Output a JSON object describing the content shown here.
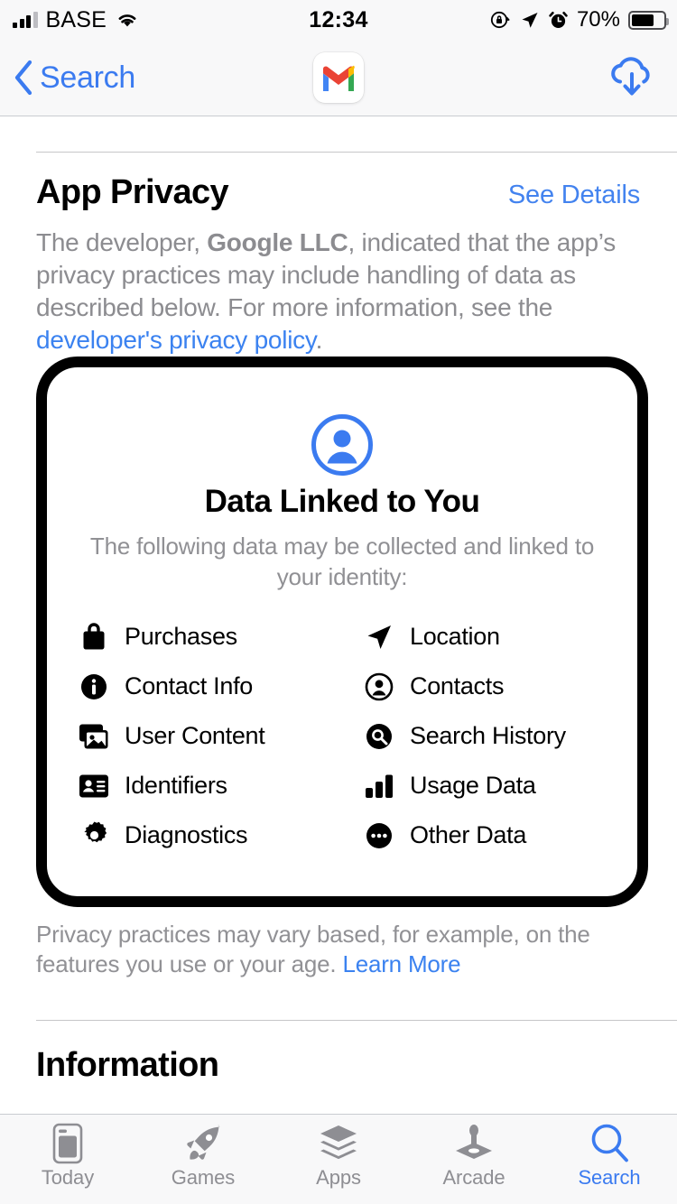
{
  "status_bar": {
    "carrier": "BASE",
    "time": "12:34",
    "battery_percent": "70%",
    "icons": [
      "signal-bars-icon",
      "wifi-icon",
      "rotation-lock-icon",
      "location-arrow-icon",
      "alarm-clock-icon",
      "battery-icon"
    ]
  },
  "nav_bar": {
    "back_label": "Search",
    "app_icon": "gmail-app-icon",
    "download_icon": "cloud-download-icon"
  },
  "app_privacy": {
    "title": "App Privacy",
    "see_details": "See Details",
    "intro_prefix": "The developer, ",
    "developer": "Google LLC",
    "intro_middle": ", indicated that the app’s privacy practices may include handling of data as described below. For more information, see the ",
    "privacy_policy_link": "developer's privacy policy",
    "intro_suffix": "."
  },
  "privacy_card": {
    "icon": "person-circle-icon",
    "title": "Data Linked to You",
    "subtitle": "The following data may be collected and linked to your identity:",
    "items_left": [
      {
        "label": "Purchases",
        "icon": "shopping-bag-icon"
      },
      {
        "label": "Contact Info",
        "icon": "info-circle-icon"
      },
      {
        "label": "User Content",
        "icon": "photo-stack-icon"
      },
      {
        "label": "Identifiers",
        "icon": "contact-card-icon"
      },
      {
        "label": "Diagnostics",
        "icon": "gear-icon"
      }
    ],
    "items_right": [
      {
        "label": "Location",
        "icon": "location-arrow-icon"
      },
      {
        "label": "Contacts",
        "icon": "person-circle-outline-icon"
      },
      {
        "label": "Search History",
        "icon": "search-circle-icon"
      },
      {
        "label": "Usage Data",
        "icon": "bar-chart-icon"
      },
      {
        "label": "Other Data",
        "icon": "ellipsis-circle-icon"
      }
    ]
  },
  "footnote": {
    "text": "Privacy practices may vary based, for example, on the features you use or your age. ",
    "link": "Learn More"
  },
  "information": {
    "title": "Information"
  },
  "tab_bar": {
    "tabs": [
      {
        "label": "Today",
        "icon": "today-phone-icon",
        "active": false
      },
      {
        "label": "Games",
        "icon": "rocket-icon",
        "active": false
      },
      {
        "label": "Apps",
        "icon": "stack-icon",
        "active": false
      },
      {
        "label": "Arcade",
        "icon": "joystick-icon",
        "active": false
      },
      {
        "label": "Search",
        "icon": "search-icon",
        "active": true
      }
    ]
  },
  "colors": {
    "accent": "#3b7bf0",
    "link": "#3b82f0",
    "muted_text": "#8c8c90",
    "chrome_bg": "#f8f8f9"
  }
}
